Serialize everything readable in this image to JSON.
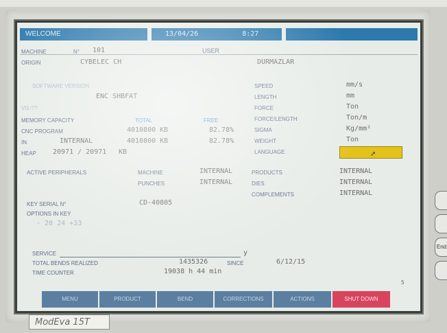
{
  "header": {
    "welcome": "WELCOME",
    "date": "13/04/26",
    "time": "8:27"
  },
  "machine": {
    "label": "MACHINE",
    "no_label": "N°",
    "number": "101",
    "user_label": "USER",
    "user": "DURMAZLAR",
    "origin_label": "ORIGIN",
    "origin": "CYBELEC CH"
  },
  "software": {
    "label": "SOFTWARE VERSION",
    "value": "ENC SHBFAT",
    "sub": "VI1-??"
  },
  "memory": {
    "label": "MEMORY CAPACITY",
    "total_label": "TOTAL",
    "free_label": "FREE",
    "rows": [
      {
        "label": "CNC PROGRAM",
        "total": "4010800 KB",
        "free": "82.78%"
      },
      {
        "label": "IN",
        "type": "INTERNAL",
        "total": "4010800 KB",
        "free": "82.78%"
      }
    ],
    "heap_label": "HEAP",
    "heap_value": "20971 / 20971",
    "heap_unit": "KB"
  },
  "units": {
    "rows": [
      {
        "label": "SPEED",
        "value": "mm/s"
      },
      {
        "label": "LENGTH",
        "value": "mm"
      },
      {
        "label": "FORCE",
        "value": "Ton"
      },
      {
        "label": "FORCE/LENGTH",
        "value": "Ton/m"
      },
      {
        "label": "SIGMA",
        "value": "Kg/mm²"
      },
      {
        "label": "WEIGHT",
        "value": "Ton"
      },
      {
        "label": "LANGUAGE",
        "value": ""
      }
    ]
  },
  "peripherals": {
    "label": "ACTIVE PERIPHERALS",
    "left": [
      {
        "label": "MACHINE",
        "value": "INTERNAL"
      },
      {
        "label": "PUNCHES",
        "value": "INTERNAL"
      }
    ],
    "right": [
      {
        "label": "PRODUCTS",
        "value": "INTERNAL"
      },
      {
        "label": "DIES",
        "value": "INTERNAL"
      },
      {
        "label": "COMPLEMENTS",
        "value": "INTERNAL"
      }
    ]
  },
  "key": {
    "serial_label": "KEY SERIAL N°",
    "serial": "CD-40805",
    "options_label": "OPTIONS IN KEY",
    "options": "- 20 24 +33"
  },
  "service": {
    "label": "SERVICE",
    "suffix": "y",
    "bends_label": "TOTAL BENDS REALIZED",
    "bends": "1435326",
    "since_label": "SINCE",
    "since": "6/12/15",
    "time_label": "TIME COUNTER",
    "time": "19038 h  44 min"
  },
  "page_number": "5",
  "softkeys": [
    "MENU",
    "PRODUCT",
    "BEND",
    "CORRECTIONS",
    "ACTIONS",
    "SHUT DOWN"
  ],
  "bezel": {
    "model": "ModEva 15T",
    "side_buttons": [
      "",
      "",
      "End",
      ""
    ]
  },
  "colors": {
    "titlebar": "#2b79ad",
    "softkey": "#5b7fa0",
    "shutdown": "#d8445e",
    "language_field": "#e4c21c"
  }
}
